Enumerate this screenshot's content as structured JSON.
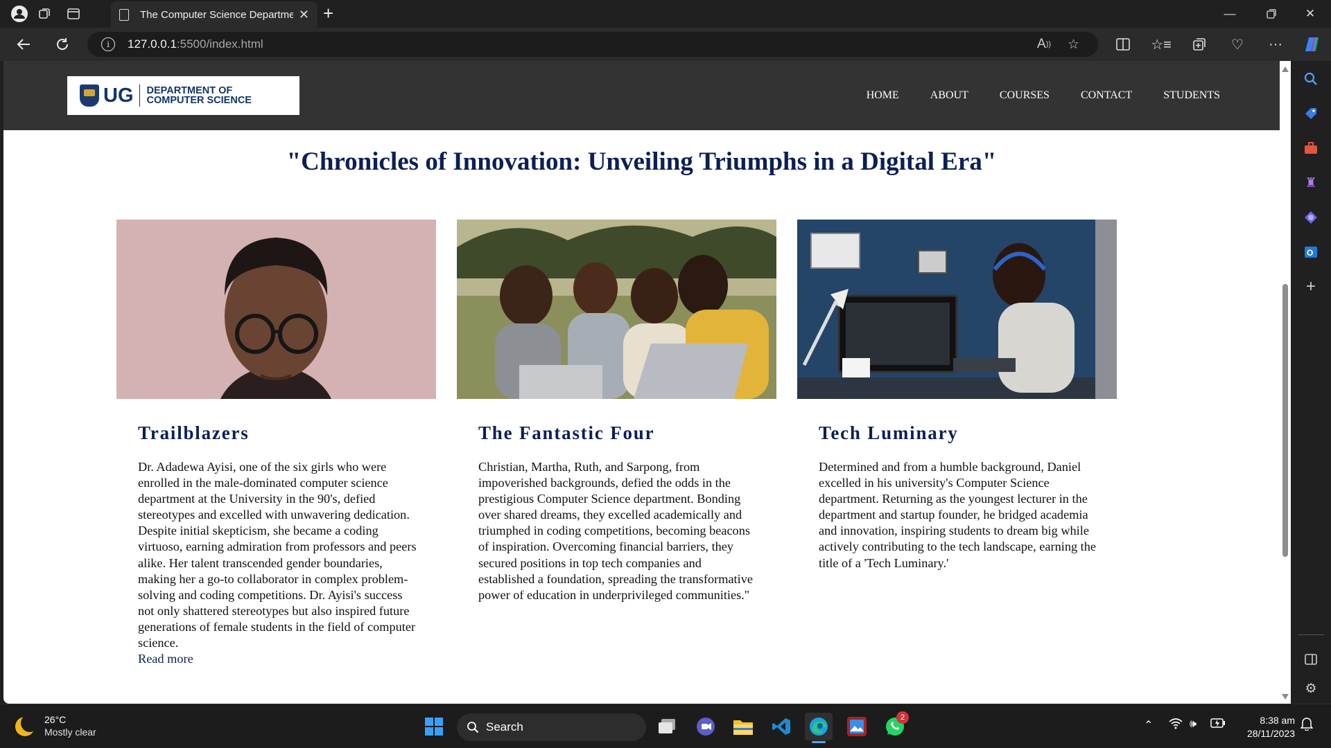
{
  "browser": {
    "tab_title": "The Computer Science Department",
    "url_host": "127.0.0.1",
    "url_path": ":5500/index.html"
  },
  "site": {
    "logo_ug": "UG",
    "logo_dept_line1": "DEPARTMENT OF",
    "logo_dept_line2": "COMPUTER SCIENCE",
    "nav": [
      "HOME",
      "ABOUT",
      "COURSES",
      "CONTACT",
      "STUDENTS"
    ]
  },
  "page": {
    "title": "\"Chronicles of Innovation: Unveiling Triumphs in a Digital Era\"",
    "cards": [
      {
        "heading": "Trailblazers",
        "body": "Dr. Adadewa Ayisi, one of the six girls who were enrolled in the male-dominated computer science department at the University in the 90's, defied stereotypes and excelled with unwavering dedication. Despite initial skepticism, she became a coding virtuoso, earning admiration from professors and peers alike. Her talent transcended gender boundaries, making her a go-to collaborator in complex problem-solving and coding competitions. Dr. Ayisi's success not only shattered stereotypes but also inspired future generations of female students in the field of computer science.",
        "link": "Read more"
      },
      {
        "heading": "The Fantastic Four",
        "body": "Christian, Martha, Ruth, and Sarpong, from impoverished backgrounds, defied the odds in the prestigious Computer Science department. Bonding over shared dreams, they excelled academically and triumphed in coding competitions, becoming beacons of inspiration. Overcoming financial barriers, they secured positions in top tech companies and established a foundation, spreading the transformative power of education in underprivileged communities.\""
      },
      {
        "heading": "Tech Luminary",
        "body": "Determined and from a humble background, Daniel excelled in his university's Computer Science department. Returning as the youngest lecturer in the department and startup founder, he bridged academia and innovation, inspiring students to dream big while actively contributing to the tech landscape, earning the title of a 'Tech Luminary.'"
      }
    ]
  },
  "taskbar": {
    "temperature": "26°C",
    "weather": "Mostly clear",
    "search_label": "Search",
    "time": "8:38 am",
    "date": "28/11/2023",
    "whatsapp_badge": "2"
  }
}
